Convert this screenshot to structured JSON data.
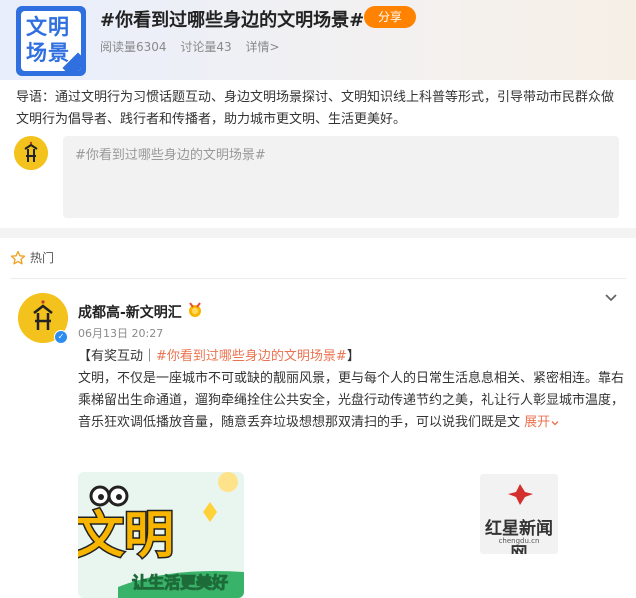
{
  "header": {
    "logo_line1": "文明",
    "logo_line2": "场景",
    "title": "#你看到过哪些身边的文明场景#",
    "share_label": "分享",
    "read_count": "阅读量6304",
    "discuss_count": "讨论量43",
    "details_label": "详情>"
  },
  "intro": {
    "text": "导语：通过文明行为习惯话题互动、身边文明场景探讨、文明知识线上科普等形式，引导带动市民群众做文明行为倡导者、践行者和传播者，助力城市更文明、生活更美好。"
  },
  "composer": {
    "placeholder": "#你看到过哪些身边的文明场景#"
  },
  "hot_section": {
    "label": "热门"
  },
  "post": {
    "author": "成都高-新文明汇",
    "time": "06月13日 20:27",
    "tag_prefix": "【有奖互动｜",
    "tag_hashtag": "#你看到过哪些身边的文明场景#",
    "tag_suffix": "】",
    "body": "文明，不仅是一座城市不可或缺的靓丽风景，更与每个人的日常生活息息相关、紧密相连。靠右乘梯留出生命通道，遛狗牵绳拴住公共安全，光盘行动传递节约之美，礼让行人彰显城市温度，音乐狂欢调低播放音量，随意丢弃垃圾想想那双清扫的手，可以说我们既是文",
    "expand_label": "展开",
    "image1_text_top": "文明",
    "image1_text_bottom": "让生活更美好",
    "image2_logo_text": "红星新闻网",
    "image2_site": "chengdu.cn"
  },
  "colors": {
    "accent_orange": "#ff8200",
    "link_orange": "#eb7350",
    "brand_blue": "#2f6fe0",
    "avatar_yellow": "#f4c21c"
  },
  "icons": {
    "hot": "star-outline-icon",
    "verified": "verified-badge-icon",
    "author_badge": "medal-icon",
    "expand": "chevron-down-icon",
    "more": "chevron-down-icon"
  }
}
